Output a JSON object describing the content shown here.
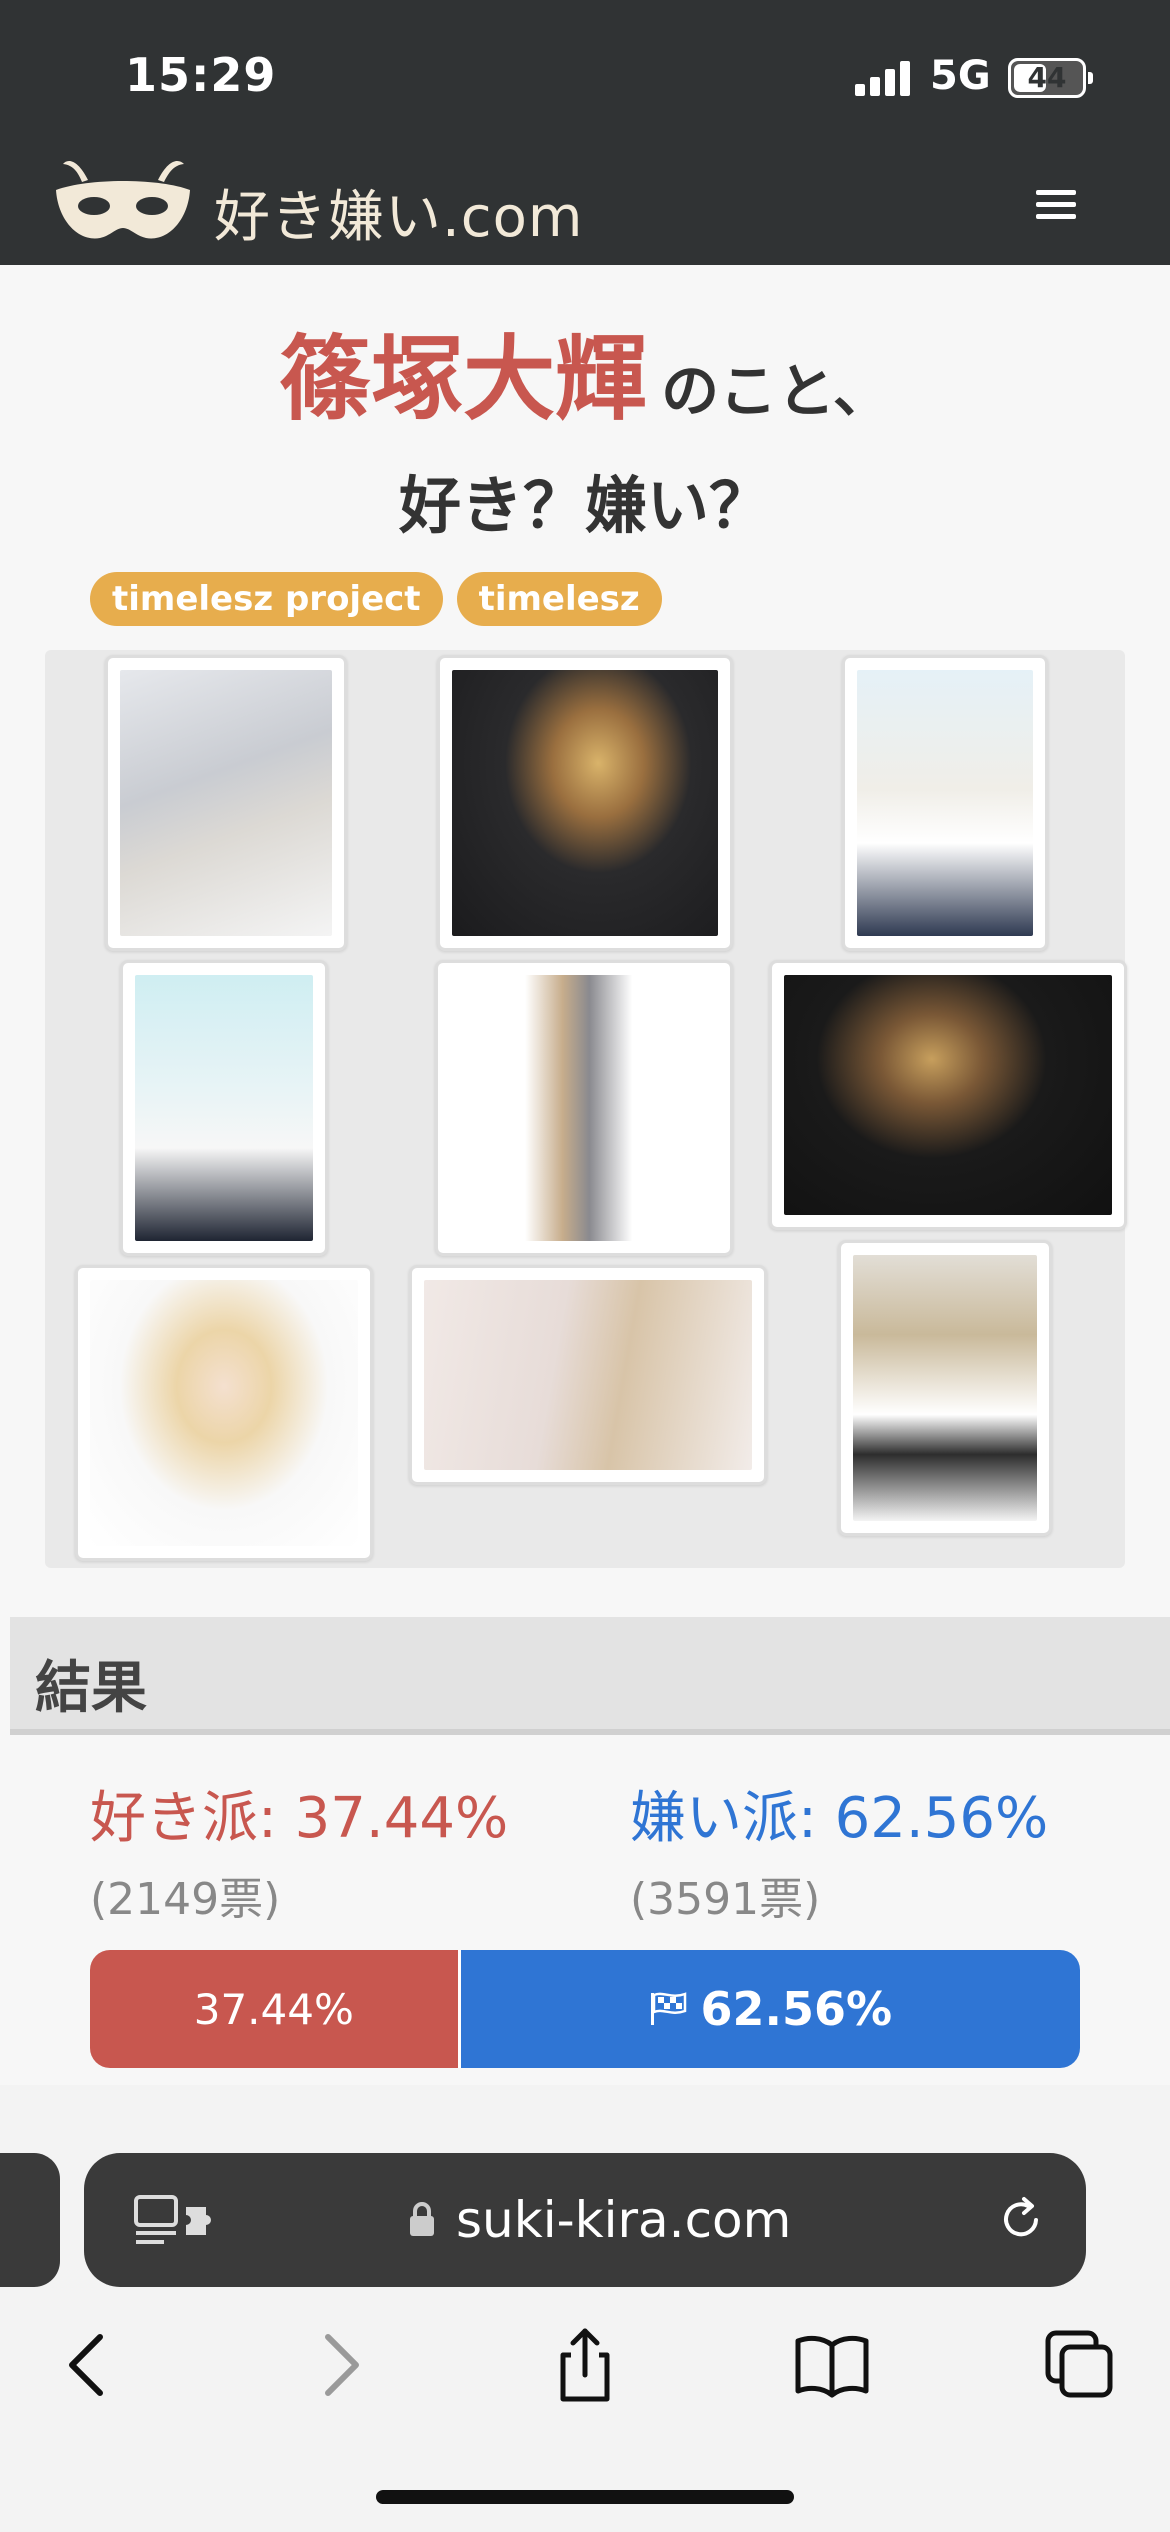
{
  "status_bar": {
    "time": "15:29",
    "network": "5G",
    "battery": "44",
    "battery_level": 0.44
  },
  "header": {
    "logo_text": "好き嫌い.com",
    "logo_icon": "mask-icon",
    "menu_icon": "hamburger-menu-icon"
  },
  "title": {
    "name": "篠塚大輝",
    "suffix": "のこと、",
    "question": "好き？嫌い？"
  },
  "tags": [
    "timelesz project",
    "timelesz"
  ],
  "results": {
    "heading": "結果",
    "like_label": "好き派: 37.44%",
    "dislike_label": "嫌い派: 62.56%",
    "like_votes": "(2149票)",
    "dislike_votes": "(3591票)",
    "like_bar_text": "37.44%",
    "dislike_bar_text": "62.56%",
    "like_fraction": 0.3744,
    "like_color": "#c8574f",
    "dislike_color": "#2f75d4"
  },
  "browser": {
    "url": "suki-kira.com",
    "reader_icon": "reader-extension-icon",
    "lock_icon": "lock-icon",
    "reload_icon": "reload-icon",
    "toolbar": [
      "back-icon",
      "forward-icon",
      "share-icon",
      "bookmarks-icon",
      "tabs-icon"
    ]
  }
}
